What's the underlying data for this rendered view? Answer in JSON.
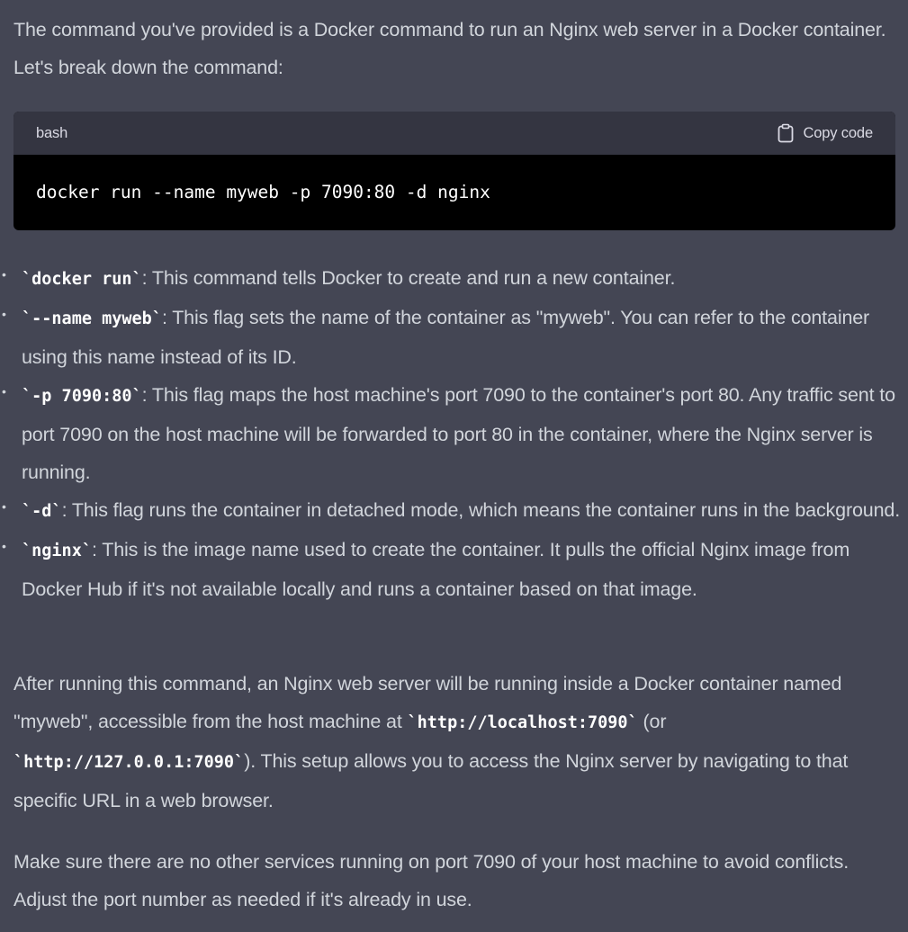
{
  "intro": "The command you've provided is a Docker command to run an Nginx web server in a Docker container. Let's break down the command:",
  "code_block": {
    "language": "bash",
    "copy_label": "Copy code",
    "copy_icon": "clipboard-icon",
    "code": "docker run --name myweb -p 7090:80 -d nginx"
  },
  "bullets": [
    {
      "code": "`docker run`",
      "text": ": This command tells Docker to create and run a new container."
    },
    {
      "code": "`--name myweb`",
      "text": ": This flag sets the name of the container as \"myweb\". You can refer to the container using this name instead of its ID."
    },
    {
      "code": "`-p 7090:80`",
      "text": ": This flag maps the host machine's port 7090 to the container's port 80. Any traffic sent to port 7090 on the host machine will be forwarded to port 80 in the container, where the Nginx server is running."
    },
    {
      "code": "`-d`",
      "text": ": This flag runs the container in detached mode, which means the container runs in the background."
    },
    {
      "code": "`nginx`",
      "text": ": This is the image name used to create the container. It pulls the official Nginx image from Docker Hub if it's not available locally and runs a container based on that image."
    }
  ],
  "after": {
    "part1": "After running this command, an Nginx web server will be running inside a Docker container named \"myweb\", accessible from the host machine at ",
    "code1": "`http://localhost:7090`",
    "part2": " (or ",
    "code2": "`http://127.0.0.1:7090`",
    "part3": "). This setup allows you to access the Nginx server by navigating to that specific URL in a web browser."
  },
  "closing": "Make sure there are no other services running on port 7090 of your host machine to avoid conflicts. Adjust the port number as needed if it's already in use."
}
